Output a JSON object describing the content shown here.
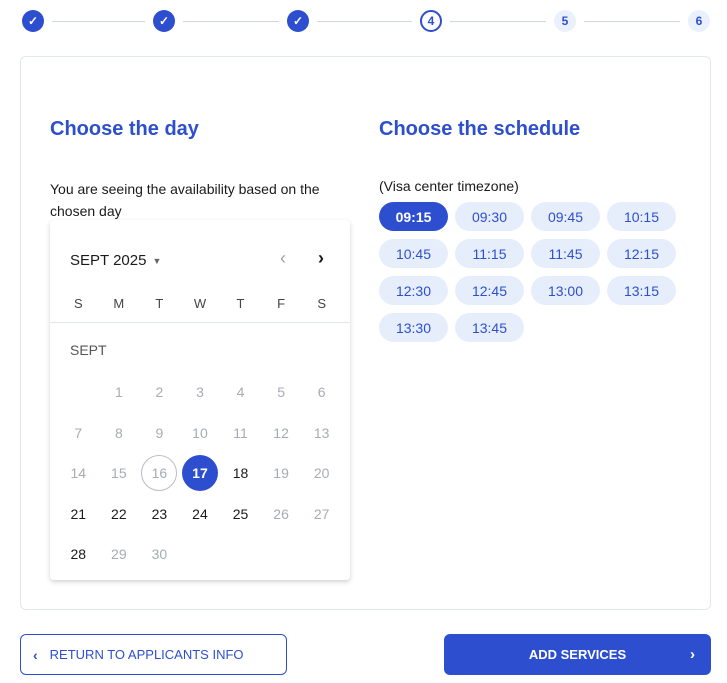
{
  "stepper": {
    "steps": [
      {
        "label": "",
        "state": "done"
      },
      {
        "label": "",
        "state": "done"
      },
      {
        "label": "",
        "state": "done"
      },
      {
        "label": "4",
        "state": "current"
      },
      {
        "label": "5",
        "state": "future"
      },
      {
        "label": "6",
        "state": "future"
      }
    ],
    "check_glyph": "✓"
  },
  "day_section": {
    "title": "Choose the day",
    "description": "You are seeing the availability based on the chosen day"
  },
  "calendar": {
    "month_label": "SEPT 2025",
    "month_caret": "▼",
    "prev_glyph": "‹",
    "next_glyph": "›",
    "weekdays": [
      "S",
      "M",
      "T",
      "W",
      "T",
      "F",
      "S"
    ],
    "month_short": "SEPT",
    "selected_day": 17,
    "today_day": 16,
    "weeks": [
      [
        null,
        1,
        2,
        3,
        4,
        5,
        6
      ],
      [
        7,
        8,
        9,
        10,
        11,
        12,
        13
      ],
      [
        14,
        15,
        16,
        17,
        18,
        19,
        20
      ],
      [
        21,
        22,
        23,
        24,
        25,
        26,
        27
      ],
      [
        28,
        29,
        30,
        null,
        null,
        null,
        null
      ]
    ],
    "available_days": [
      17,
      18,
      21,
      22,
      23,
      24,
      25,
      28
    ]
  },
  "schedule_section": {
    "title": "Choose the schedule",
    "timezone_note": "(Visa center timezone)",
    "selected_slot": "09:15",
    "slots": [
      "09:15",
      "09:30",
      "09:45",
      "10:15",
      "10:45",
      "11:15",
      "11:45",
      "12:15",
      "12:30",
      "12:45",
      "13:00",
      "13:15",
      "13:30",
      "13:45"
    ]
  },
  "actions": {
    "back_label": "RETURN TO APPLICANTS INFO",
    "back_glyph": "‹",
    "next_label": "ADD SERVICES",
    "next_glyph": "›"
  },
  "colors": {
    "accent": "#2d4fcf",
    "slot_bg": "#e6eefc",
    "muted_text": "#a7acb3"
  }
}
